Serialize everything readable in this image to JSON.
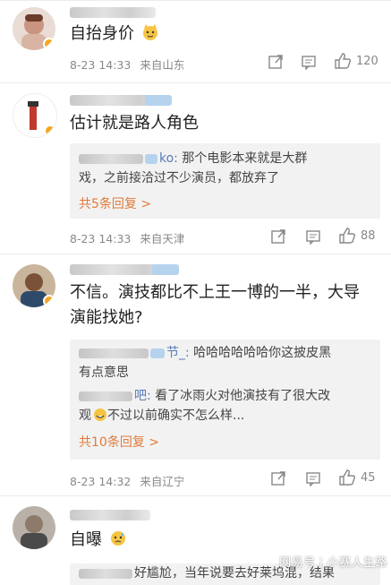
{
  "comments": [
    {
      "text": "自抬身价",
      "emoji": "cat-face-emoji",
      "date": "8-23 14:33",
      "location": "来自山东",
      "like_count": "120"
    },
    {
      "text": "估计就是路人角色",
      "replies": [
        {
          "author_suffix": "ko:",
          "text_line1": " 那个电影本来就是大群",
          "text_line2": "戏，之前接洽过不少演员，都放弃了"
        }
      ],
      "more_replies": "共5条回复 >",
      "date": "8-23 14:33",
      "location": "来自天津",
      "like_count": "88"
    },
    {
      "text_line1": "不信。演技都比不上王一博的一半，大导",
      "text_line2": "演能找她?",
      "replies": [
        {
          "author_suffix": "节_:",
          "text_line1": " 哈哈哈哈哈哈你这披皮黑",
          "text_line2": "有点意思"
        },
        {
          "author_suffix": "吧:",
          "text_line1": " 看了冰雨火对他演技有了很大改",
          "text_line2": "观",
          "text_line2_rest": "不过以前确实不怎么样..."
        }
      ],
      "more_replies": "共10条回复 >",
      "date": "8-23 14:32",
      "location": "来自辽宁",
      "like_count": "45"
    },
    {
      "text": "自曝",
      "emoji": "sweat-face-emoji",
      "partial_reply": "好尴尬，当年说要去好莱坞混，结果"
    }
  ],
  "watermark": {
    "left": "网易号",
    "right": "小赛人生路"
  },
  "colors": {
    "accent_orange": "#e07b3a",
    "meta_gray": "#888888",
    "reply_bg": "#f2f2f2"
  },
  "icons": [
    "share-icon",
    "comment-icon",
    "like-icon"
  ]
}
